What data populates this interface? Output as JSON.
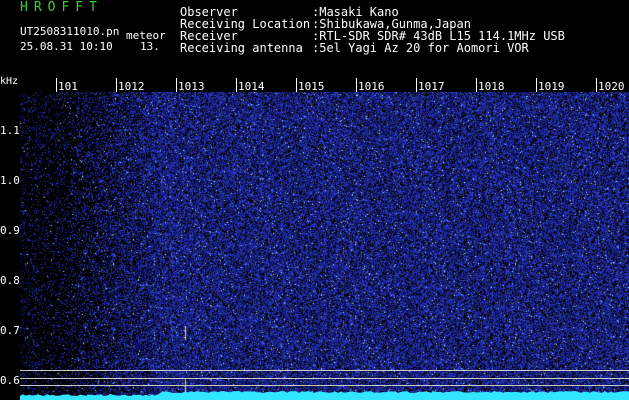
{
  "app": {
    "title": "HROFFT"
  },
  "file": {
    "name": "UT2508311010.pn",
    "mode": "meteor",
    "timestamp": "25.08.31 10:10",
    "counter": "13."
  },
  "info": [
    {
      "label": "Observer",
      "value": ":Masaki Kano"
    },
    {
      "label": "Receiving Location",
      "value": ":Shibukawa,Gunma,Japan"
    },
    {
      "label": "Receiver",
      "value": ":RTL-SDR SDR# 43dB L15 114.1MHz USB"
    },
    {
      "label": "Receiving antenna",
      "value": ":5el Yagi Az 20 for Aomori VOR"
    }
  ],
  "axis": {
    "unit": "kHz",
    "x_ticks": [
      "101",
      "1012",
      "1013",
      "1014",
      "1015",
      "1016",
      "1017",
      "1018",
      "1019",
      "1020"
    ],
    "y_ticks": [
      "1.1",
      "1.0",
      "0.9",
      "0.8",
      "0.7",
      "0.6"
    ]
  },
  "colors": {
    "title": "#31d431",
    "noise": "#1e2a9c",
    "floor": "#33e6ff"
  }
}
